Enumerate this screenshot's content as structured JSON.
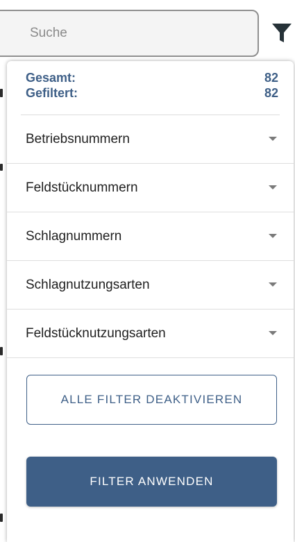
{
  "search": {
    "placeholder": "Suche"
  },
  "filter_toggle": {
    "icon": "filter-funnel-icon",
    "color": "#263238"
  },
  "summary": {
    "total_label": "Gesamt:",
    "total_value": "82",
    "filtered_label": "Gefiltert:",
    "filtered_value": "82"
  },
  "filters": [
    {
      "label": "Betriebsnummern",
      "icon": "chevron-down-icon"
    },
    {
      "label": "Feldstücknummern",
      "icon": "chevron-down-icon"
    },
    {
      "label": "Schlagnummern",
      "icon": "chevron-down-icon"
    },
    {
      "label": "Schlagnutzungsarten",
      "icon": "chevron-down-icon"
    },
    {
      "label": "Feldstücknutzungsarten",
      "icon": "chevron-down-icon"
    }
  ],
  "actions": {
    "deactivate_all_label": "ALLE FILTER DEAKTIVIEREN",
    "apply_label": "FILTER ANWENDEN"
  },
  "colors": {
    "accent": "#3e5f87",
    "text": "#1f1f1f",
    "divider": "#dedede"
  }
}
